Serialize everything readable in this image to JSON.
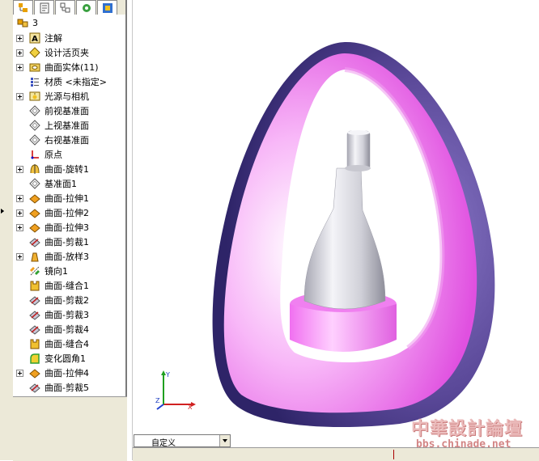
{
  "tree": {
    "root_label": "3",
    "items": [
      {
        "label": "注解",
        "icon": "annotation-icon",
        "expandable": true
      },
      {
        "label": "设计活页夹",
        "icon": "design-binder-icon",
        "expandable": true
      },
      {
        "label": "曲面实体(11)",
        "icon": "surface-bodies-icon",
        "expandable": true
      },
      {
        "label": "材质 <未指定>",
        "icon": "material-icon",
        "expandable": false
      },
      {
        "label": "光源与相机",
        "icon": "lights-camera-icon",
        "expandable": true
      },
      {
        "label": "前视基准面",
        "icon": "plane-icon",
        "expandable": false
      },
      {
        "label": "上视基准面",
        "icon": "plane-icon",
        "expandable": false
      },
      {
        "label": "右视基准面",
        "icon": "plane-icon",
        "expandable": false
      },
      {
        "label": "原点",
        "icon": "origin-icon",
        "expandable": false
      },
      {
        "label": "曲面-旋转1",
        "icon": "surface-revolve-icon",
        "expandable": true
      },
      {
        "label": "基准面1",
        "icon": "plane-icon",
        "expandable": false
      },
      {
        "label": "曲面-拉伸1",
        "icon": "surface-extrude-icon",
        "expandable": true
      },
      {
        "label": "曲面-拉伸2",
        "icon": "surface-extrude-icon",
        "expandable": true
      },
      {
        "label": "曲面-拉伸3",
        "icon": "surface-extrude-icon",
        "expandable": true
      },
      {
        "label": "曲面-剪裁1",
        "icon": "surface-trim-icon",
        "expandable": false
      },
      {
        "label": "曲面-放样3",
        "icon": "surface-loft-icon",
        "expandable": true
      },
      {
        "label": "镜向1",
        "icon": "mirror-icon",
        "expandable": false
      },
      {
        "label": "曲面-缝合1",
        "icon": "surface-knit-icon",
        "expandable": false
      },
      {
        "label": "曲面-剪裁2",
        "icon": "surface-trim-icon",
        "expandable": false
      },
      {
        "label": "曲面-剪裁3",
        "icon": "surface-trim-icon",
        "expandable": false
      },
      {
        "label": "曲面-剪裁4",
        "icon": "surface-trim-icon",
        "expandable": false
      },
      {
        "label": "曲面-缝合4",
        "icon": "surface-knit-icon",
        "expandable": false
      },
      {
        "label": "变化圆角1",
        "icon": "variable-fillet-icon",
        "expandable": false
      },
      {
        "label": "曲面-拉伸4",
        "icon": "surface-extrude-icon",
        "expandable": true
      },
      {
        "label": "曲面-剪裁5",
        "icon": "surface-trim-icon",
        "expandable": false
      }
    ]
  },
  "combo": {
    "value": "自定义"
  },
  "watermark": {
    "title": "中華設計論壇",
    "url": "bbs.chinade.net"
  },
  "colors": {
    "outer_ring": "#4a3a8a",
    "inner_pink": "#e060e0",
    "bottle": "#d8d8e0"
  }
}
